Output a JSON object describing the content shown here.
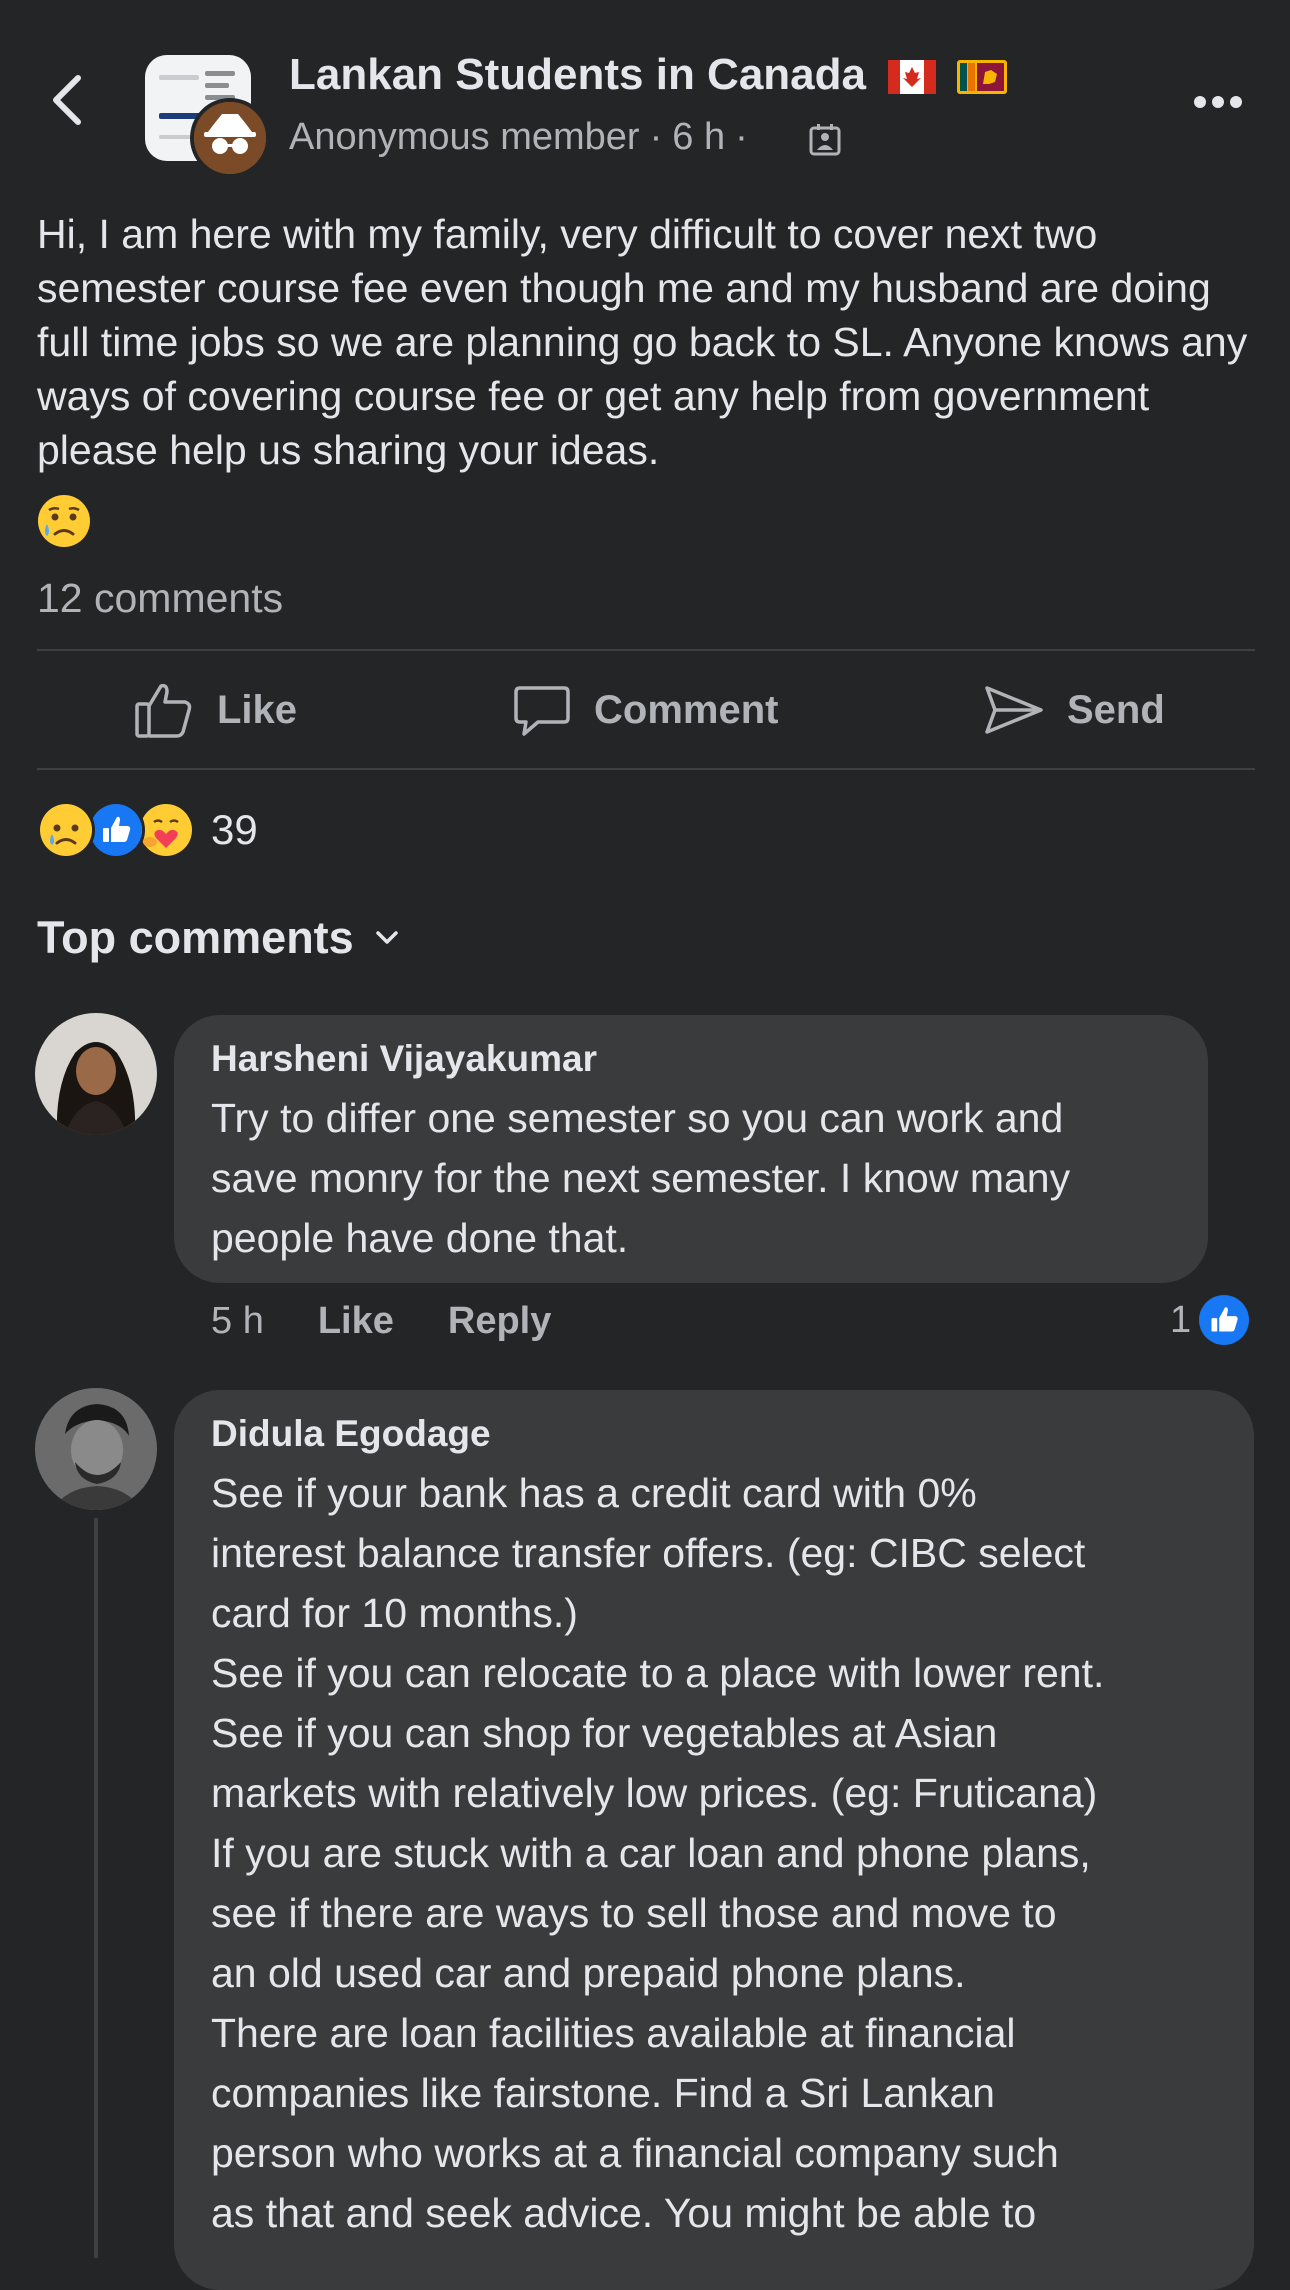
{
  "header": {
    "group_name": "Lankan Students in Canada",
    "author": "Anonymous member",
    "time": "6 h",
    "flags": [
      "canada-flag",
      "sri-lanka-flag"
    ]
  },
  "post": {
    "text": "Hi, I am here with my family, very difficult to cover next two semester course fee even though me and my husband are doing full time jobs so we are planning go back to SL. Anyone knows any ways of covering course fee or get any help from government please help us sharing your ideas.",
    "emoji": "sad-but-relieved-face",
    "comment_count": "12 comments"
  },
  "actions": {
    "like": "Like",
    "comment": "Comment",
    "send": "Send"
  },
  "reactions": {
    "icons": [
      "sad-icon",
      "like-icon",
      "care-icon"
    ],
    "count": "39"
  },
  "top_comments_label": "Top comments",
  "comments": [
    {
      "name": "Harsheni Vijayakumar",
      "lines": [
        "Try to differ one semester so you can work and",
        "save monry for the next semester. I know many",
        "people have done that."
      ],
      "time": "5 h",
      "like": "Like",
      "reply": "Reply",
      "like_count": "1"
    },
    {
      "name": "Didula Egodage",
      "lines": [
        "See if your bank has a credit card with 0%",
        "interest balance transfer offers. (eg: CIBC select",
        "card for 10 months.)",
        "See if you can relocate to a place with lower rent.",
        "See if you can shop for vegetables at Asian",
        "markets with relatively low prices. (eg: Fruticana)",
        "If you are stuck with a car loan and phone plans,",
        "see if there are ways to sell those and move to",
        "an old used car and prepaid phone plans.",
        "There are loan facilities available at financial",
        "companies like fairstone. Find a Sri Lankan",
        "person who works at a financial company such",
        "as that and seek advice. You might be able to"
      ]
    }
  ],
  "colors": {
    "background": "#242526",
    "bubble": "#3a3b3c",
    "text_primary": "#e4e6eb",
    "text_secondary": "#b0b3b8",
    "like_blue": "#1877f2"
  }
}
